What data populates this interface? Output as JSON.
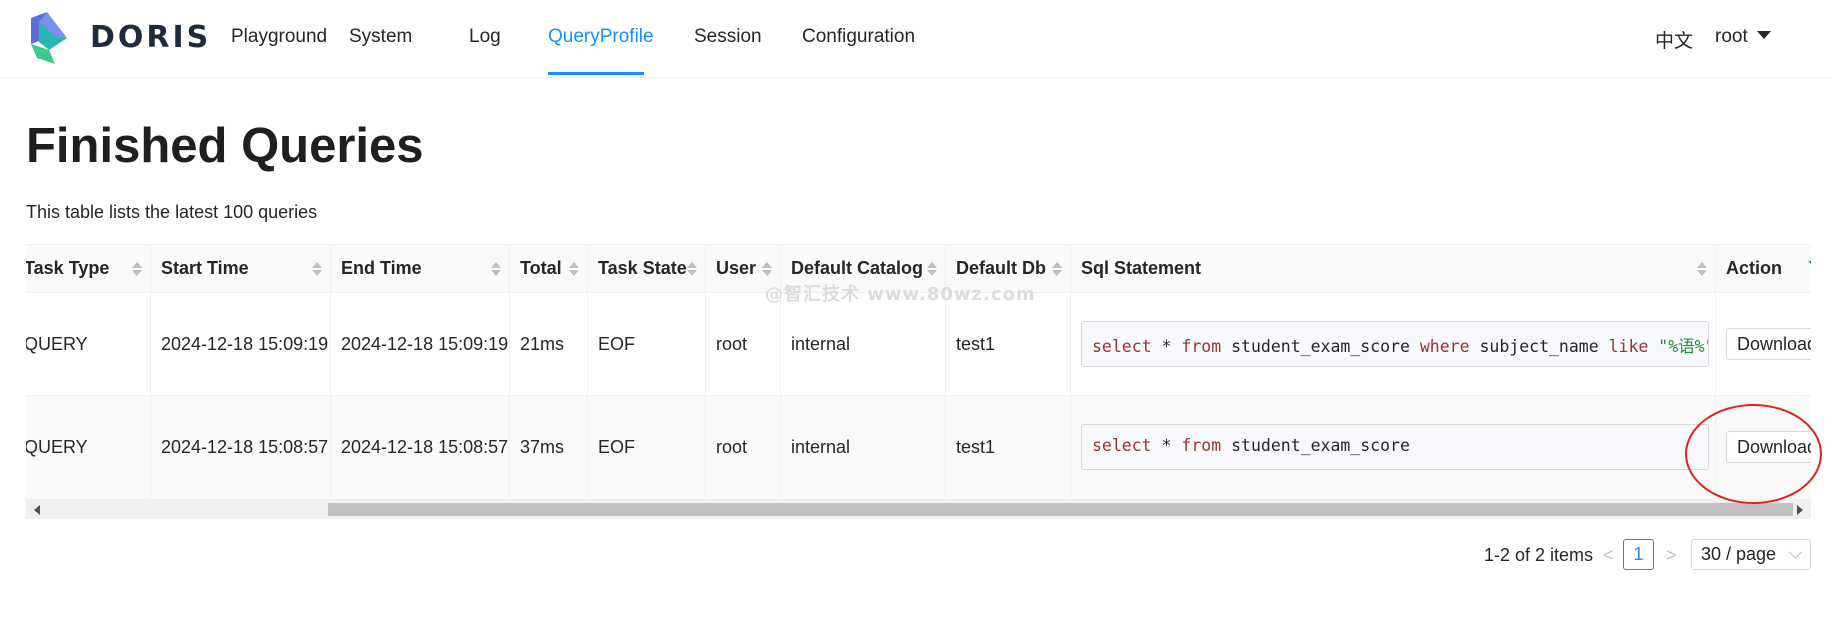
{
  "header": {
    "brand": "DORIS",
    "nav": [
      {
        "label": "Playground"
      },
      {
        "label": "System"
      },
      {
        "label": "Log"
      },
      {
        "label": "QueryProfile",
        "active": true
      },
      {
        "label": "Session"
      },
      {
        "label": "Configuration"
      }
    ],
    "language": "中文",
    "user": "root"
  },
  "page": {
    "title": "Finished Queries",
    "subtitle": "This table lists the latest 100 queries"
  },
  "table": {
    "columns": [
      "Task Type",
      "Start Time",
      "End Time",
      "Total",
      "Task State",
      "User",
      "Default Catalog",
      "Default Db",
      "Sql Statement",
      "Action"
    ],
    "rows": [
      {
        "task_type": "QUERY",
        "start_time": "2024-12-18 15:09:19",
        "end_time": "2024-12-18 15:09:19",
        "total": "21ms",
        "task_state": "EOF",
        "user": "root",
        "catalog": "internal",
        "db": "test1",
        "sql": {
          "k1": "select",
          "p1": " * ",
          "k2": "from",
          "p2": " student_exam_score ",
          "k3": "where",
          "p3": " subject_name ",
          "k4": "like",
          "p4": " ",
          "s1": "\"%语%\""
        },
        "action": "Download"
      },
      {
        "task_type": "QUERY",
        "start_time": "2024-12-18 15:08:57",
        "end_time": "2024-12-18 15:08:57",
        "total": "37ms",
        "task_state": "EOF",
        "user": "root",
        "catalog": "internal",
        "db": "test1",
        "sql": {
          "k1": "select",
          "p1": " * ",
          "k2": "from",
          "p2": " student_exam_score"
        },
        "action": "Download"
      }
    ]
  },
  "watermark": "@智汇技术 www.80wz.com",
  "pagination": {
    "total_text": "1-2 of 2 items",
    "prev": "<",
    "current_page": "1",
    "next": ">",
    "page_size": "30 / page"
  },
  "colors": {
    "accent": "#1890ff",
    "annotation": "#e0231c",
    "sql_keyword": "#a0312f",
    "sql_string": "#2a8a32"
  }
}
